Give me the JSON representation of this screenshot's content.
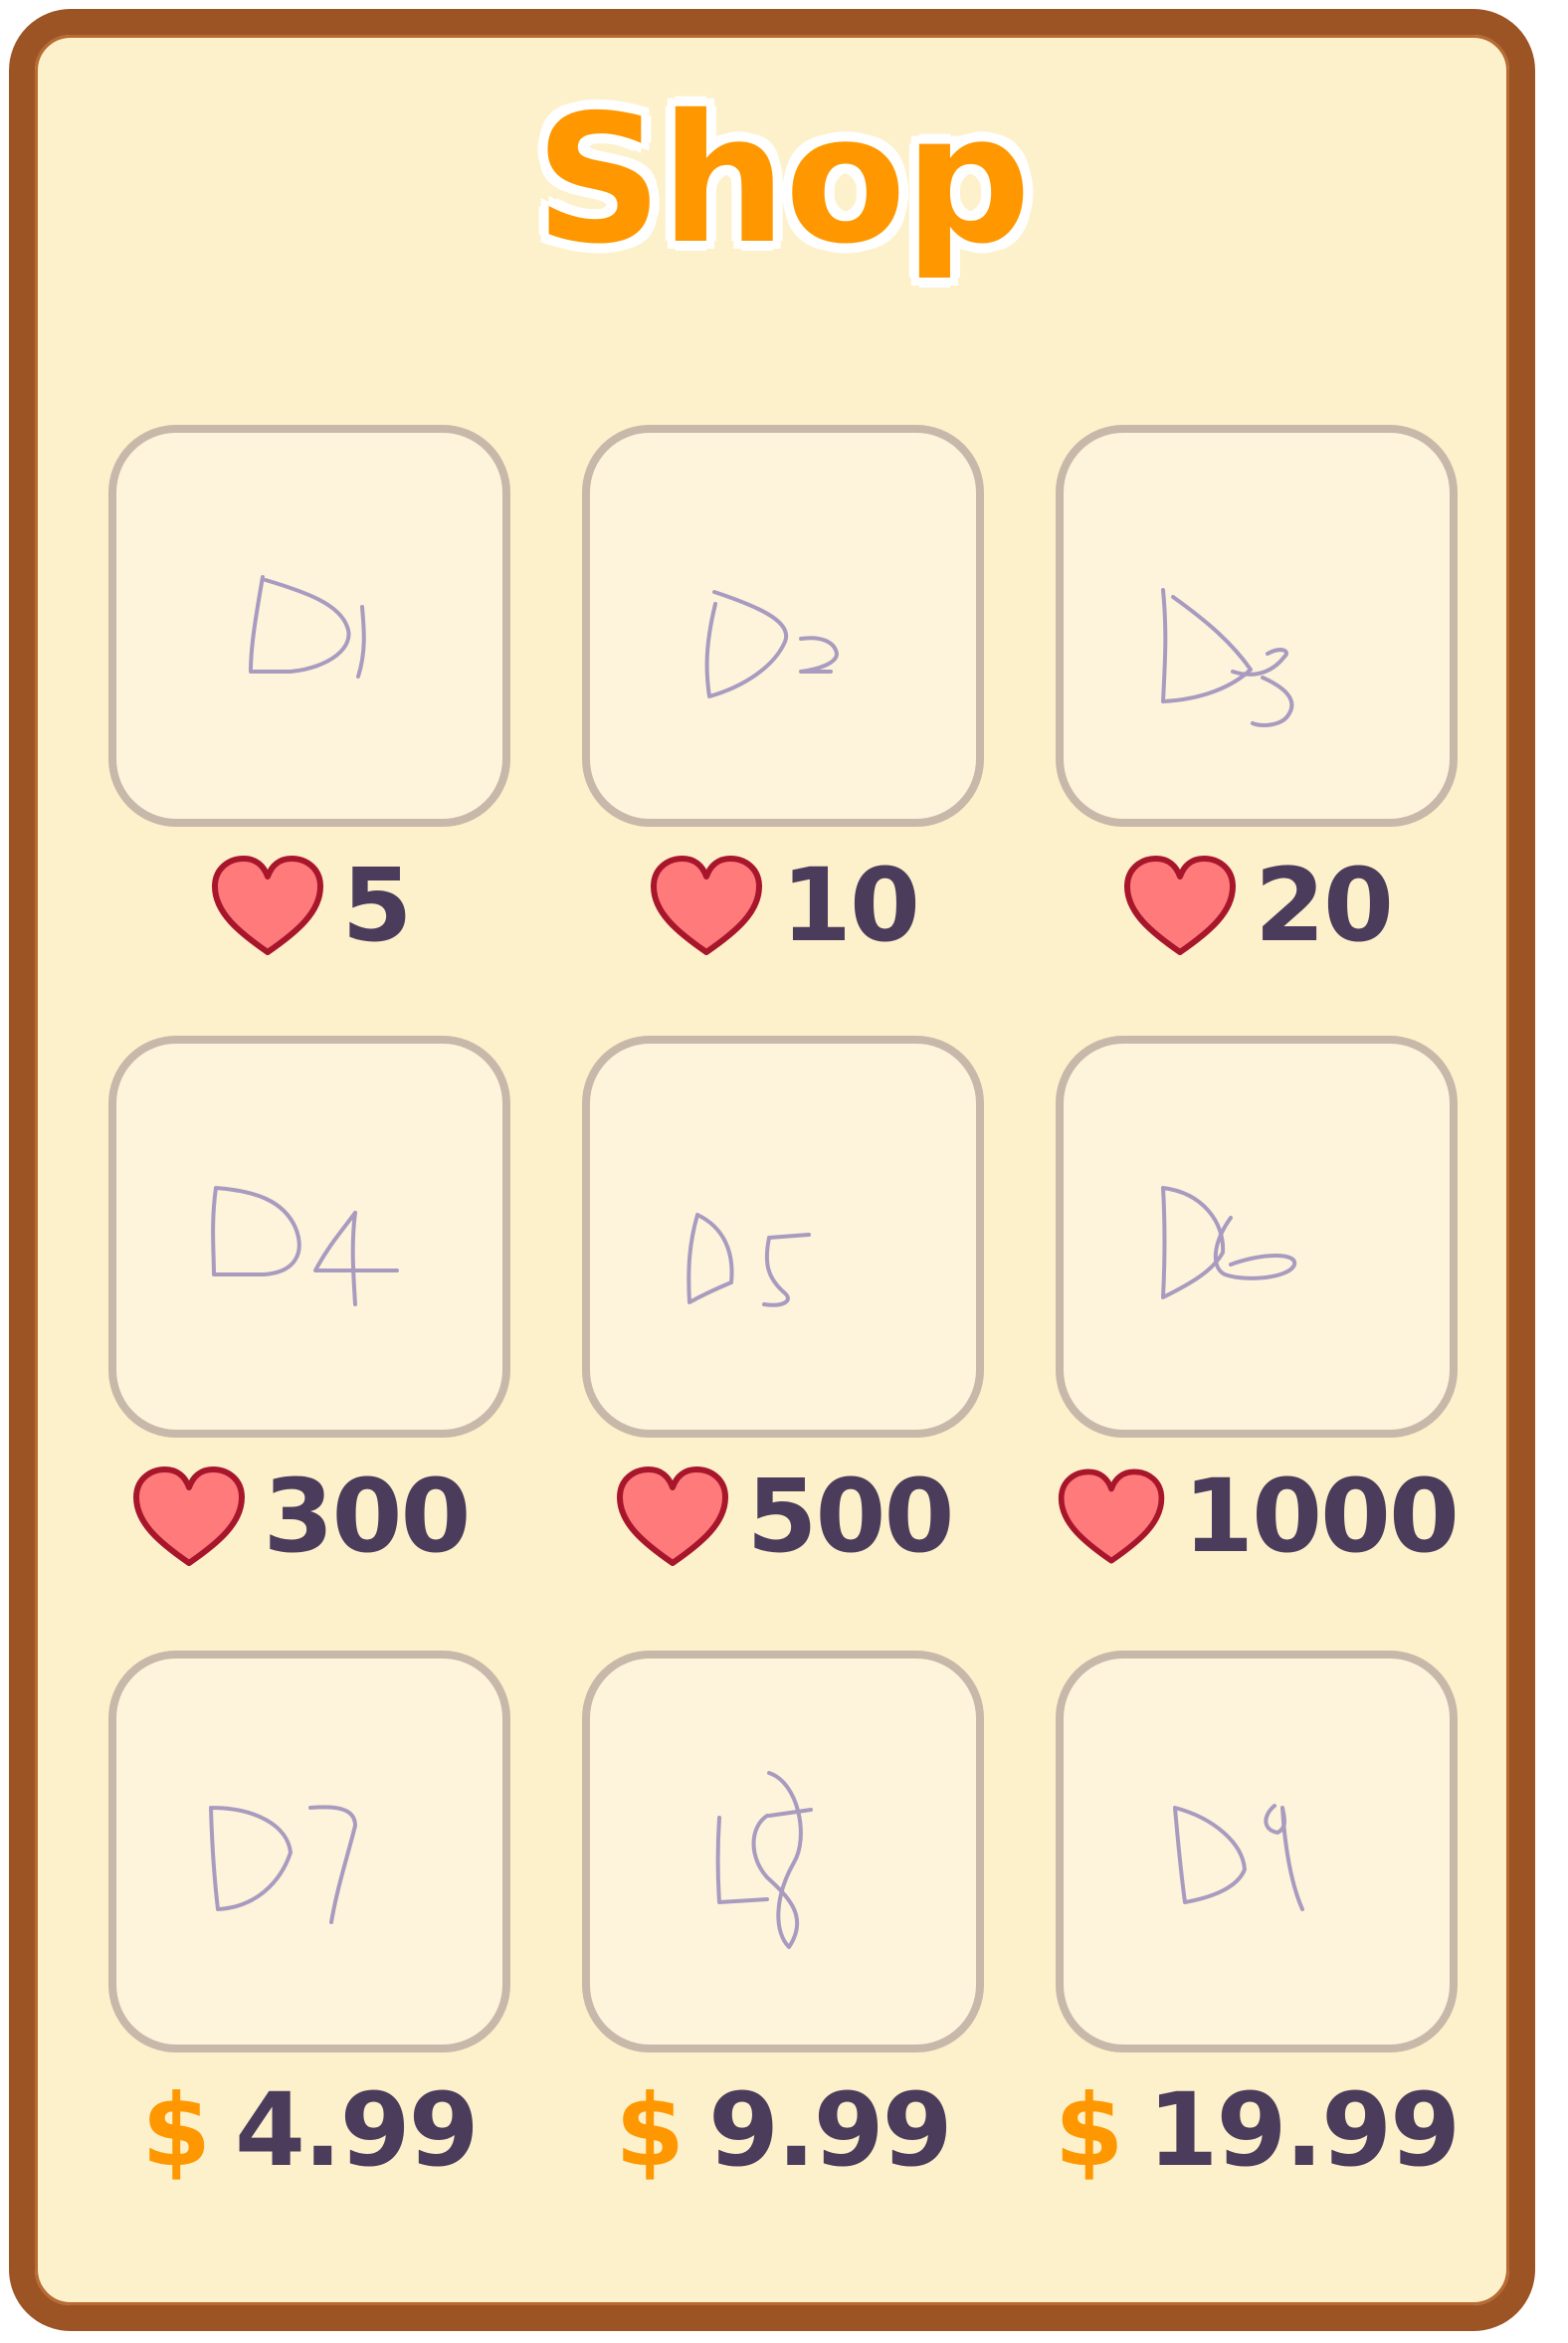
{
  "shop": {
    "title": "Shop",
    "colors": {
      "frame": "#9d5424",
      "panel": "#fdf1cc",
      "title": "#ff9800",
      "tile_border": "#c7b8aa",
      "heart_fill": "#ff7a7a",
      "heart_outline": "#a8162c",
      "price_text": "#4b3c5c",
      "dollar": "#ff9800"
    },
    "items": [
      {
        "label": "D1",
        "currency": "heart-icon",
        "price": "5"
      },
      {
        "label": "D2",
        "currency": "heart-icon",
        "price": "10"
      },
      {
        "label": "D3",
        "currency": "heart-icon",
        "price": "20"
      },
      {
        "label": "D4",
        "currency": "heart-icon",
        "price": "300"
      },
      {
        "label": "D5",
        "currency": "heart-icon",
        "price": "500"
      },
      {
        "label": "D6",
        "currency": "heart-icon",
        "price": "1000"
      },
      {
        "label": "D7",
        "currency": "$",
        "price": "4.99"
      },
      {
        "label": "D8",
        "currency": "$",
        "price": "9.99"
      },
      {
        "label": "D9",
        "currency": "$",
        "price": "19.99"
      }
    ]
  }
}
